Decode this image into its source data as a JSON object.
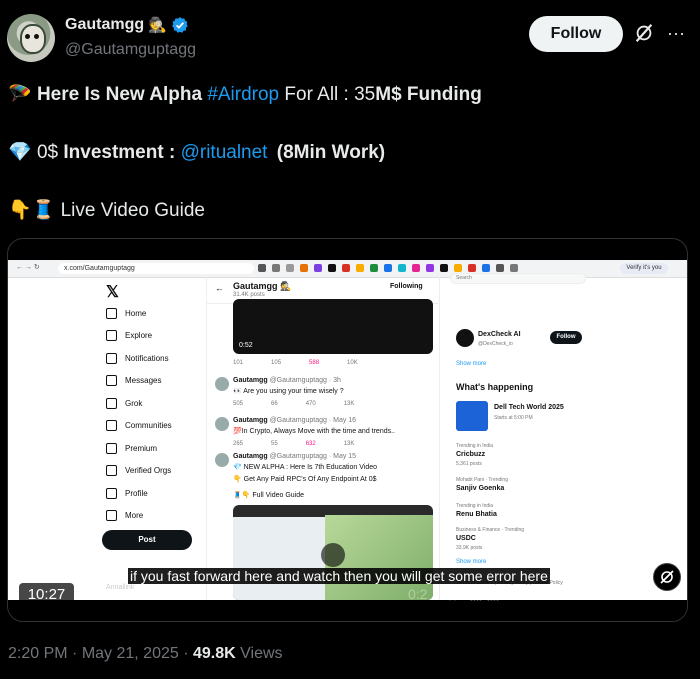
{
  "author": {
    "display_name": "Gautamgg",
    "name_emoji": "🕵️",
    "handle": "@Gautamguptagg",
    "verified": true
  },
  "actions": {
    "follow_label": "Follow",
    "grok_icon": "grok-icon",
    "more_icon": "more-icon"
  },
  "tweet": {
    "line1": {
      "emoji": "🪂",
      "part1": "Here Is New Alpha",
      "hashtag": "#Airdrop",
      "part2": "For All : 35",
      "part3": "M$ Funding"
    },
    "line2": {
      "emoji": "💎",
      "part1": "0$",
      "part2": "Investment :",
      "mention": "@ritualnet",
      "part3": "(8Min Work)"
    },
    "line3": {
      "emoji": "👇🧵",
      "text": "Live Video Guide"
    }
  },
  "video": {
    "browser_url": "x.com/Gautamguptagg",
    "verify_pill": "Verify it's you",
    "left_nav": [
      "Home",
      "Explore",
      "Notifications",
      "Messages",
      "Grok",
      "Communities",
      "Premium",
      "Verified Orgs",
      "Profile",
      "More"
    ],
    "post_button": "Post",
    "small_user": "Annallink",
    "center": {
      "title": "Gautamgg 🕵️",
      "subtitle": "31.4K posts",
      "follow_label": "Following",
      "video_time": "0:52",
      "stats1": [
        "101",
        "105",
        "588",
        "10K"
      ],
      "posts": [
        {
          "name": "Gautamgg",
          "meta": "@Gautamguptagg · 3h",
          "text": "👀 Are you using your time wisely ?",
          "stats": [
            "505",
            "66",
            "470",
            "13K"
          ]
        },
        {
          "name": "Gautamgg",
          "meta": "@Gautamguptagg · May 16",
          "text": "💯In Crypto, Always Move with the time and trends..",
          "stats": [
            "265",
            "55",
            "632",
            "13K"
          ]
        },
        {
          "name": "Gautamgg",
          "meta": "@Gautamguptagg · May 15",
          "text": "💎 NEW ALPHA : Here Is 7th Education Video",
          "text2": "👇 Get Any Paid RPC's Of Any Endpoint At 0$",
          "text3": "🧵👇 Full Video Guide"
        }
      ]
    },
    "right": {
      "search_placeholder": "Search",
      "card_name": "DexCheck AI",
      "card_handle": "@DexCheck_io",
      "card_follow": "Follow",
      "show_more": "Show more",
      "happening_title": "What's happening",
      "event_title": "Dell Tech World 2025",
      "event_sub": "Starts at 5:00 PM",
      "trends": [
        {
          "ctx": "Trending in India",
          "name": "Cricbuzz",
          "posts": "5,361 posts"
        },
        {
          "ctx": "Mohabt Pani · Trending",
          "name": "Sanjiv Goenka",
          "posts": ""
        },
        {
          "ctx": "Trending in India",
          "name": "Renu Bhatia",
          "posts": ""
        },
        {
          "ctx": "Business & Finance · Trending",
          "name": "USDC",
          "posts": "33.9K posts"
        }
      ],
      "show_more2": "Show more",
      "footer": "Terms of Service | Privacy Policy | Cookie Policy"
    },
    "caption": "if you fast forward here and watch then you will get some error here",
    "duration": "10:27",
    "progress_fraction": 0.0
  },
  "meta": {
    "time": "2:20 PM",
    "date": "May 21, 2025",
    "views_count": "49.8K",
    "views_label": "Views"
  },
  "colors": {
    "background": "#000000",
    "link": "#1d9bf0",
    "follow_bg": "#eff3f4",
    "muted": "#71767b"
  }
}
